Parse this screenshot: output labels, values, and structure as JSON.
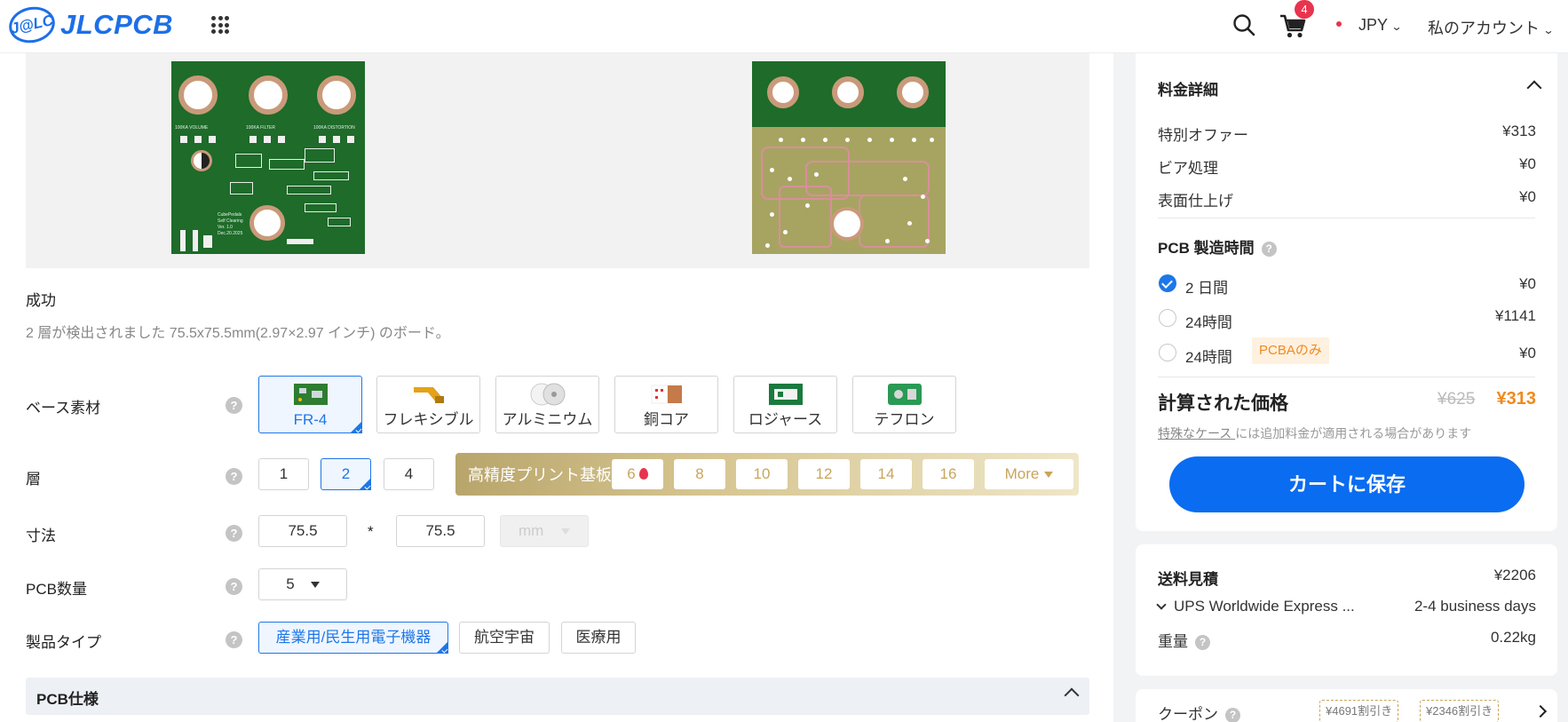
{
  "header": {
    "logo_badge": "J@LC",
    "logo_text": "JLCPCB",
    "cart_count": "4",
    "currency": "JPY",
    "account": "私のアカウント"
  },
  "upload": {
    "status": "成功",
    "detected": "2 層が検出されました 75.5x75.5mm(2.97×2.97 インチ) のボード。",
    "board_silk": [
      "100KA VOLUME",
      "100KA FILTER",
      "100KA DISTORTION",
      "CubePedals",
      "Self Clearing",
      "Ver. 1.0",
      "Dec.20.2025"
    ]
  },
  "form": {
    "base_material": {
      "label": "ベース素材",
      "options": [
        "FR-4",
        "フレキシブル",
        "アルミニウム",
        "銅コア",
        "ロジャース",
        "テフロン"
      ],
      "selected": "FR-4"
    },
    "layers": {
      "label": "層",
      "options": [
        "1",
        "2",
        "4"
      ],
      "selected": "2",
      "high_precision_label": "高精度プリント基板",
      "high_precision_options": [
        "6",
        "8",
        "10",
        "12",
        "14",
        "16"
      ],
      "more_label": "More"
    },
    "dimensions": {
      "label": "寸法",
      "width": "75.5",
      "height": "75.5",
      "separator": "*",
      "unit": "mm"
    },
    "quantity": {
      "label": "PCB数量",
      "value": "5"
    },
    "product_type": {
      "label": "製品タイプ",
      "options": [
        "産業用/民生用電子機器",
        "航空宇宙",
        "医療用"
      ],
      "selected": "産業用/民生用電子機器"
    },
    "spec_section": "PCB仕様"
  },
  "pricing": {
    "title": "料金詳細",
    "lines": [
      {
        "label": "特別オファー",
        "value": "¥313"
      },
      {
        "label": "ビア処理",
        "value": "¥0"
      },
      {
        "label": "表面仕上げ",
        "value": "¥0"
      }
    ],
    "build_time_title": "PCB 製造時間",
    "build_times": [
      {
        "label": "2 日間",
        "value": "¥0",
        "selected": true
      },
      {
        "label": "24時間",
        "value": "¥1141",
        "selected": false
      },
      {
        "label": "24時間",
        "value": "¥0",
        "selected": false,
        "tag": "PCBAのみ"
      }
    ],
    "calculated_label": "計算された価格",
    "old_price": "¥625",
    "new_price": "¥313",
    "note_link": "特殊なケース ",
    "note_text": "には追加料金が適用される場合があります",
    "save_button": "カートに保存"
  },
  "shipping": {
    "title": "送料見積",
    "cost": "¥2206",
    "method": "UPS Worldwide Express ...",
    "days": "2-4 business days",
    "weight_label": "重量",
    "weight": "0.22kg"
  },
  "coupon": {
    "label": "クーポン",
    "items": [
      "¥4691割引き",
      "¥2346割引き"
    ]
  },
  "colors": {
    "accent": "#1d77e8",
    "orange": "#f08a1d",
    "badge_red": "#e8344e",
    "gold": "#c9a55c",
    "pcb_green": "#1e6b2a"
  }
}
